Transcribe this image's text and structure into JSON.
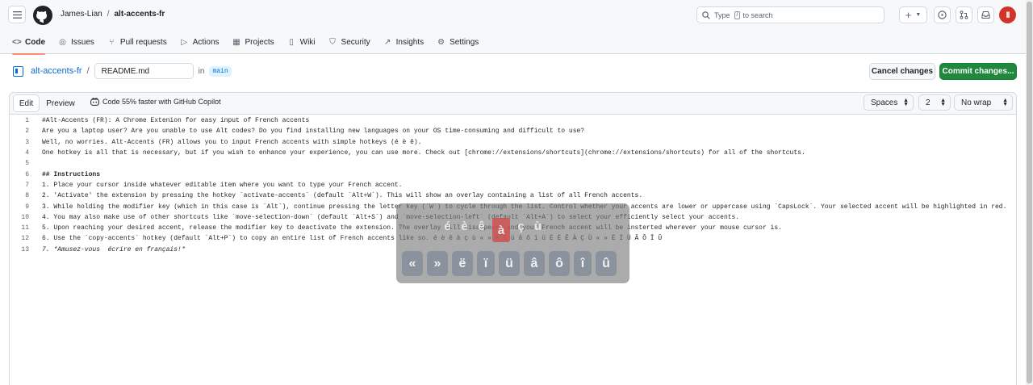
{
  "header": {
    "owner": "James-Lian",
    "separator": "/",
    "repo": "alt-accents-fr",
    "search_placeholder_prefix": "Type",
    "search_key": "/",
    "search_placeholder_suffix": "to search",
    "plus_label": "+",
    "avatar_text": "II"
  },
  "nav": {
    "tabs": [
      {
        "label": "Code",
        "icon": "code-icon"
      },
      {
        "label": "Issues",
        "icon": "issue-icon"
      },
      {
        "label": "Pull requests",
        "icon": "pull-request-icon"
      },
      {
        "label": "Actions",
        "icon": "play-icon"
      },
      {
        "label": "Projects",
        "icon": "table-icon"
      },
      {
        "label": "Wiki",
        "icon": "book-icon"
      },
      {
        "label": "Security",
        "icon": "shield-icon"
      },
      {
        "label": "Insights",
        "icon": "graph-icon"
      },
      {
        "label": "Settings",
        "icon": "gear-icon"
      }
    ]
  },
  "editor_header": {
    "repo_link": "alt-accents-fr",
    "slash": "/",
    "filename": "README.md",
    "in_text": "in",
    "branch": "main",
    "cancel_label": "Cancel changes",
    "commit_label": "Commit changes..."
  },
  "toolbar": {
    "edit_label": "Edit",
    "preview_label": "Preview",
    "copilot_label": "Code 55% faster with GitHub Copilot",
    "indent_mode": "Spaces",
    "indent_size": "2",
    "wrap_mode": "No wrap"
  },
  "code": {
    "lines": [
      {
        "n": "1",
        "text": "#Alt-Accents (FR): A Chrome Extenion for easy input of French accents"
      },
      {
        "n": "2",
        "text": "Are you a laptop user? Are you unable to use Alt codes? Do you find installing new languages on your OS time-consuming and difficult to use?"
      },
      {
        "n": "3",
        "text": "Well, no worries. Alt-Accents (FR) allows you to input French accents with simple hotkeys (é è ê)."
      },
      {
        "n": "4",
        "text": "One hotkey is all that is necessary, but if you wish to enhance your experience, you can use more. Check out [chrome://extensions/shortcuts](chrome://extensions/shortcuts) for all of the shortcuts."
      },
      {
        "n": "5",
        "text": ""
      },
      {
        "n": "6",
        "text": "## Instructions"
      },
      {
        "n": "7",
        "text": "1. Place your cursor inside whatever editable item where you want to type your French accent."
      },
      {
        "n": "8",
        "text": "2. 'Activate' the extension by pressing the hotkey `activate-accents` (default `Alt+W`). This will show an overlay containing a list of all French accents."
      },
      {
        "n": "9",
        "text": "3. While holding the modifier key (which in this case is `Alt`), continue pressing the letter key (`W`) to cycle through the list. Control whether your accents are lower or uppercase using `CapsLock`. Your selected accent will be highlighted in red."
      },
      {
        "n": "10",
        "text": "4. You may also make use of other shortcuts like `move-selection-down` (default `Alt+S`) and `move-selection-left` (default `Alt+A`) to select your efficiently select your accents."
      },
      {
        "n": "11",
        "text": "5. Upon reaching your desired accent, release the modifier key to deactivate the extension. The overlay will disappear, and your French accent will be insterted wherever your mouse cursor is."
      },
      {
        "n": "12",
        "text": "6. Use the `copy-accents` hotkey (default `Alt+P`) to copy an entire list of French accents like so. é è ê à ç ù « » ë ï ü â ô î û É È Ê À Ç Ù « » Ë Ï Ü Â Ô Î Û"
      },
      {
        "n": "13",
        "text": "7. *Amusez-vous  écrire en français!*"
      }
    ]
  },
  "overlay": {
    "top_row": [
      "é",
      "è",
      "ê",
      "à",
      "ç",
      "ù"
    ],
    "highlighted_index": 3,
    "bottom_keys": [
      "«",
      "»",
      "ë",
      "ï",
      "ü",
      "â",
      "ô",
      "î",
      "û"
    ],
    "highlight_color": "#cd5050"
  },
  "colors": {
    "accent_link": "#0969da",
    "commit_green": "#1f883d",
    "active_tab_underline": "#fd8c73"
  }
}
